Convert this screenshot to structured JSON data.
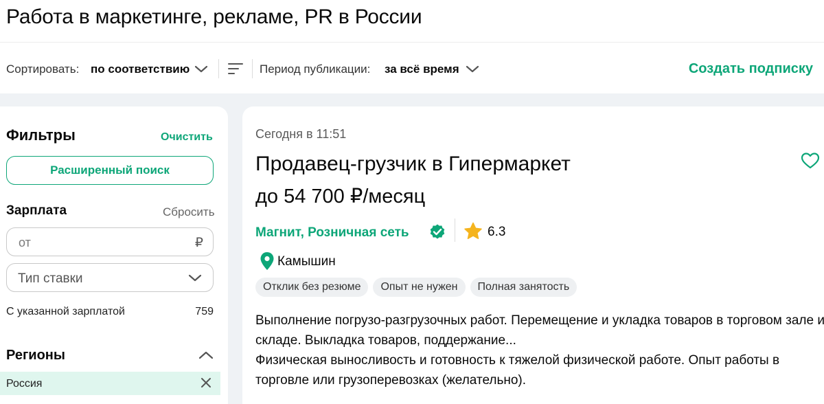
{
  "page": {
    "title": "Работа в маркетинге, рекламе, PR в России"
  },
  "sortbar": {
    "sort_label": "Сортировать:",
    "sort_value": "по соответствию",
    "period_label": "Период публикации:",
    "period_value": "за всё время",
    "subscribe_label": "Создать подписку"
  },
  "filters": {
    "title": "Фильтры",
    "clear_label": "Очистить",
    "advanced_search_label": "Расширенный поиск",
    "salary": {
      "title": "Зарплата",
      "reset_label": "Сбросить",
      "from_placeholder": "от",
      "currency": "₽",
      "rate_type_placeholder": "Тип ставки",
      "with_salary_label": "С указанной зарплатой",
      "with_salary_count": "759"
    },
    "regions": {
      "title": "Регионы",
      "selected": "Россия"
    }
  },
  "vacancy": {
    "date": "Сегодня в 11:51",
    "title": "Продавец-грузчик в Гипермаркет",
    "salary": "до 54 700 ₽/месяц",
    "company": "Магнит, Розничная сеть",
    "rating": "6.3",
    "city": "Камышин",
    "tags": [
      "Отклик без резюме",
      "Опыт не нужен",
      "Полная занятость"
    ],
    "description_1": "Выполнение погрузо-разгрузочных работ. Перемещение и укладка товаров в торговом зале и складе. Выкладка товаров, поддержание...",
    "description_2": "Физическая выносливость и готовность к тяжелой физической работе. Опыт работы в торговле или грузоперевозках (желательно)."
  },
  "colors": {
    "accent": "#0da678",
    "region_chip_bg": "#dff6ee",
    "page_bg": "#eff2f5",
    "star": "#f5b41e"
  },
  "icons": {
    "sort_chevron": "chevron-down-icon",
    "sort_lines": "sort-lines-icon",
    "heart": "heart-icon",
    "verified": "verified-check-icon",
    "star": "star-icon",
    "location": "location-pin-icon",
    "close": "close-icon",
    "regions_toggle": "chevron-up-icon"
  }
}
